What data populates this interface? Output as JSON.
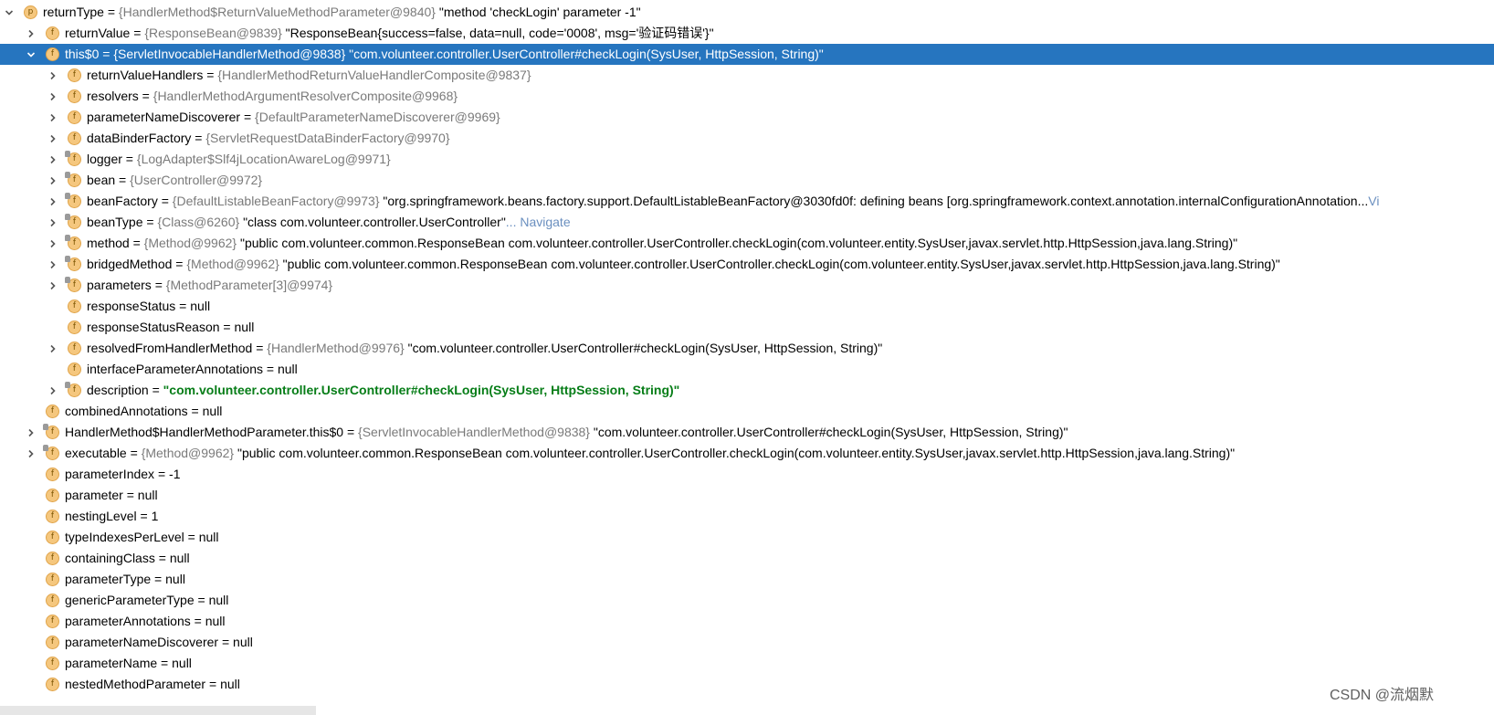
{
  "rows": [
    {
      "level": 0,
      "toggle": "expanded",
      "badge": "p",
      "locked": false,
      "name": "returnType",
      "ref": "{HandlerMethod$ReturnValueMethodParameter@9840}",
      "val": "\"method 'checkLogin' parameter -1\"",
      "nav": ""
    },
    {
      "level": 1,
      "toggle": "collapsed",
      "badge": "f",
      "locked": false,
      "name": "returnValue",
      "ref": "{ResponseBean@9839}",
      "val": "\"ResponseBean{success=false, data=null, code='0008', msg='验证码错误'}\"",
      "nav": ""
    },
    {
      "level": 1,
      "toggle": "expanded",
      "badge": "f",
      "locked": false,
      "name": "this$0",
      "ref": "{ServletInvocableHandlerMethod@9838}",
      "val": "\"com.volunteer.controller.UserController#checkLogin(SysUser, HttpSession, String)\"",
      "nav": "",
      "selected": true
    },
    {
      "level": 2,
      "toggle": "collapsed",
      "badge": "f",
      "locked": false,
      "name": "returnValueHandlers",
      "ref": "{HandlerMethodReturnValueHandlerComposite@9837}",
      "val": "",
      "nav": ""
    },
    {
      "level": 2,
      "toggle": "collapsed",
      "badge": "f",
      "locked": false,
      "name": "resolvers",
      "ref": "{HandlerMethodArgumentResolverComposite@9968}",
      "val": "",
      "nav": ""
    },
    {
      "level": 2,
      "toggle": "collapsed",
      "badge": "f",
      "locked": false,
      "name": "parameterNameDiscoverer",
      "ref": "{DefaultParameterNameDiscoverer@9969}",
      "val": "",
      "nav": ""
    },
    {
      "level": 2,
      "toggle": "collapsed",
      "badge": "f",
      "locked": false,
      "name": "dataBinderFactory",
      "ref": "{ServletRequestDataBinderFactory@9970}",
      "val": "",
      "nav": ""
    },
    {
      "level": 2,
      "toggle": "collapsed",
      "badge": "f",
      "locked": true,
      "name": "logger",
      "ref": "{LogAdapter$Slf4jLocationAwareLog@9971}",
      "val": "",
      "nav": ""
    },
    {
      "level": 2,
      "toggle": "collapsed",
      "badge": "f",
      "locked": true,
      "name": "bean",
      "ref": "{UserController@9972}",
      "val": "",
      "nav": ""
    },
    {
      "level": 2,
      "toggle": "collapsed",
      "badge": "f",
      "locked": true,
      "name": "beanFactory",
      "ref": "{DefaultListableBeanFactory@9973}",
      "val": "\"org.springframework.beans.factory.support.DefaultListableBeanFactory@3030fd0f: defining beans [org.springframework.context.annotation.internalConfigurationAnnotation...",
      "nav": "Vi"
    },
    {
      "level": 2,
      "toggle": "collapsed",
      "badge": "f",
      "locked": true,
      "name": "beanType",
      "ref": "{Class@6260}",
      "val": "\"class com.volunteer.controller.UserController\"",
      "nav": "... Navigate"
    },
    {
      "level": 2,
      "toggle": "collapsed",
      "badge": "f",
      "locked": true,
      "name": "method",
      "ref": "{Method@9962}",
      "val": "\"public com.volunteer.common.ResponseBean com.volunteer.controller.UserController.checkLogin(com.volunteer.entity.SysUser,javax.servlet.http.HttpSession,java.lang.String)\"",
      "nav": ""
    },
    {
      "level": 2,
      "toggle": "collapsed",
      "badge": "f",
      "locked": true,
      "name": "bridgedMethod",
      "ref": "{Method@9962}",
      "val": "\"public com.volunteer.common.ResponseBean com.volunteer.controller.UserController.checkLogin(com.volunteer.entity.SysUser,javax.servlet.http.HttpSession,java.lang.String)\"",
      "nav": ""
    },
    {
      "level": 2,
      "toggle": "collapsed",
      "badge": "f",
      "locked": true,
      "name": "parameters",
      "ref": "{MethodParameter[3]@9974}",
      "val": "",
      "nav": ""
    },
    {
      "level": 2,
      "toggle": "none",
      "badge": "f",
      "locked": false,
      "name": "responseStatus",
      "ref": "",
      "val": "null",
      "nav": ""
    },
    {
      "level": 2,
      "toggle": "none",
      "badge": "f",
      "locked": false,
      "name": "responseStatusReason",
      "ref": "",
      "val": "null",
      "nav": ""
    },
    {
      "level": 2,
      "toggle": "collapsed",
      "badge": "f",
      "locked": false,
      "name": "resolvedFromHandlerMethod",
      "ref": "{HandlerMethod@9976}",
      "val": "\"com.volunteer.controller.UserController#checkLogin(SysUser, HttpSession, String)\"",
      "nav": ""
    },
    {
      "level": 2,
      "toggle": "none",
      "badge": "f",
      "locked": false,
      "name": "interfaceParameterAnnotations",
      "ref": "",
      "val": "null",
      "nav": ""
    },
    {
      "level": 2,
      "toggle": "collapsed",
      "badge": "f",
      "locked": true,
      "name": "description",
      "ref": "",
      "val": "\"com.volunteer.controller.UserController#checkLogin(SysUser, HttpSession, String)\"",
      "nav": "",
      "green": true
    },
    {
      "level": 1,
      "toggle": "none",
      "badge": "f",
      "locked": false,
      "name": "combinedAnnotations",
      "ref": "",
      "val": "null",
      "nav": ""
    },
    {
      "level": 0,
      "toggle": "collapsed",
      "badge": "f",
      "locked": true,
      "name": "HandlerMethod$HandlerMethodParameter.this$0",
      "ref": "{ServletInvocableHandlerMethod@9838}",
      "val": "\"com.volunteer.controller.UserController#checkLogin(SysUser, HttpSession, String)\"",
      "nav": "",
      "indent_override": 1
    },
    {
      "level": 0,
      "toggle": "collapsed",
      "badge": "f",
      "locked": true,
      "name": "executable",
      "ref": "{Method@9962}",
      "val": "\"public com.volunteer.common.ResponseBean com.volunteer.controller.UserController.checkLogin(com.volunteer.entity.SysUser,javax.servlet.http.HttpSession,java.lang.String)\"",
      "nav": "",
      "indent_override": 1
    },
    {
      "level": 1,
      "toggle": "none",
      "badge": "f",
      "locked": false,
      "name": "parameterIndex",
      "ref": "",
      "val": "-1",
      "nav": ""
    },
    {
      "level": 1,
      "toggle": "none",
      "badge": "f",
      "locked": false,
      "name": "parameter",
      "ref": "",
      "val": "null",
      "nav": ""
    },
    {
      "level": 1,
      "toggle": "none",
      "badge": "f",
      "locked": false,
      "name": "nestingLevel",
      "ref": "",
      "val": "1",
      "nav": ""
    },
    {
      "level": 1,
      "toggle": "none",
      "badge": "f",
      "locked": false,
      "name": "typeIndexesPerLevel",
      "ref": "",
      "val": "null",
      "nav": ""
    },
    {
      "level": 1,
      "toggle": "none",
      "badge": "f",
      "locked": false,
      "name": "containingClass",
      "ref": "",
      "val": "null",
      "nav": ""
    },
    {
      "level": 1,
      "toggle": "none",
      "badge": "f",
      "locked": false,
      "name": "parameterType",
      "ref": "",
      "val": "null",
      "nav": ""
    },
    {
      "level": 1,
      "toggle": "none",
      "badge": "f",
      "locked": false,
      "name": "genericParameterType",
      "ref": "",
      "val": "null",
      "nav": ""
    },
    {
      "level": 1,
      "toggle": "none",
      "badge": "f",
      "locked": false,
      "name": "parameterAnnotations",
      "ref": "",
      "val": "null",
      "nav": ""
    },
    {
      "level": 1,
      "toggle": "none",
      "badge": "f",
      "locked": false,
      "name": "parameterNameDiscoverer",
      "ref": "",
      "val": "null",
      "nav": ""
    },
    {
      "level": 1,
      "toggle": "none",
      "badge": "f",
      "locked": false,
      "name": "parameterName",
      "ref": "",
      "val": "null",
      "nav": ""
    },
    {
      "level": 1,
      "toggle": "none",
      "badge": "f",
      "locked": false,
      "name": "nestedMethodParameter",
      "ref": "",
      "val": "null",
      "nav": ""
    }
  ],
  "watermark": "CSDN @流烟默",
  "colors": {
    "selection": "#2675bf",
    "badge_fill": "#f5c77e",
    "ref_text": "#7a7a7a",
    "string_green": "#067d17",
    "navigate_link": "#6a8fbf"
  }
}
